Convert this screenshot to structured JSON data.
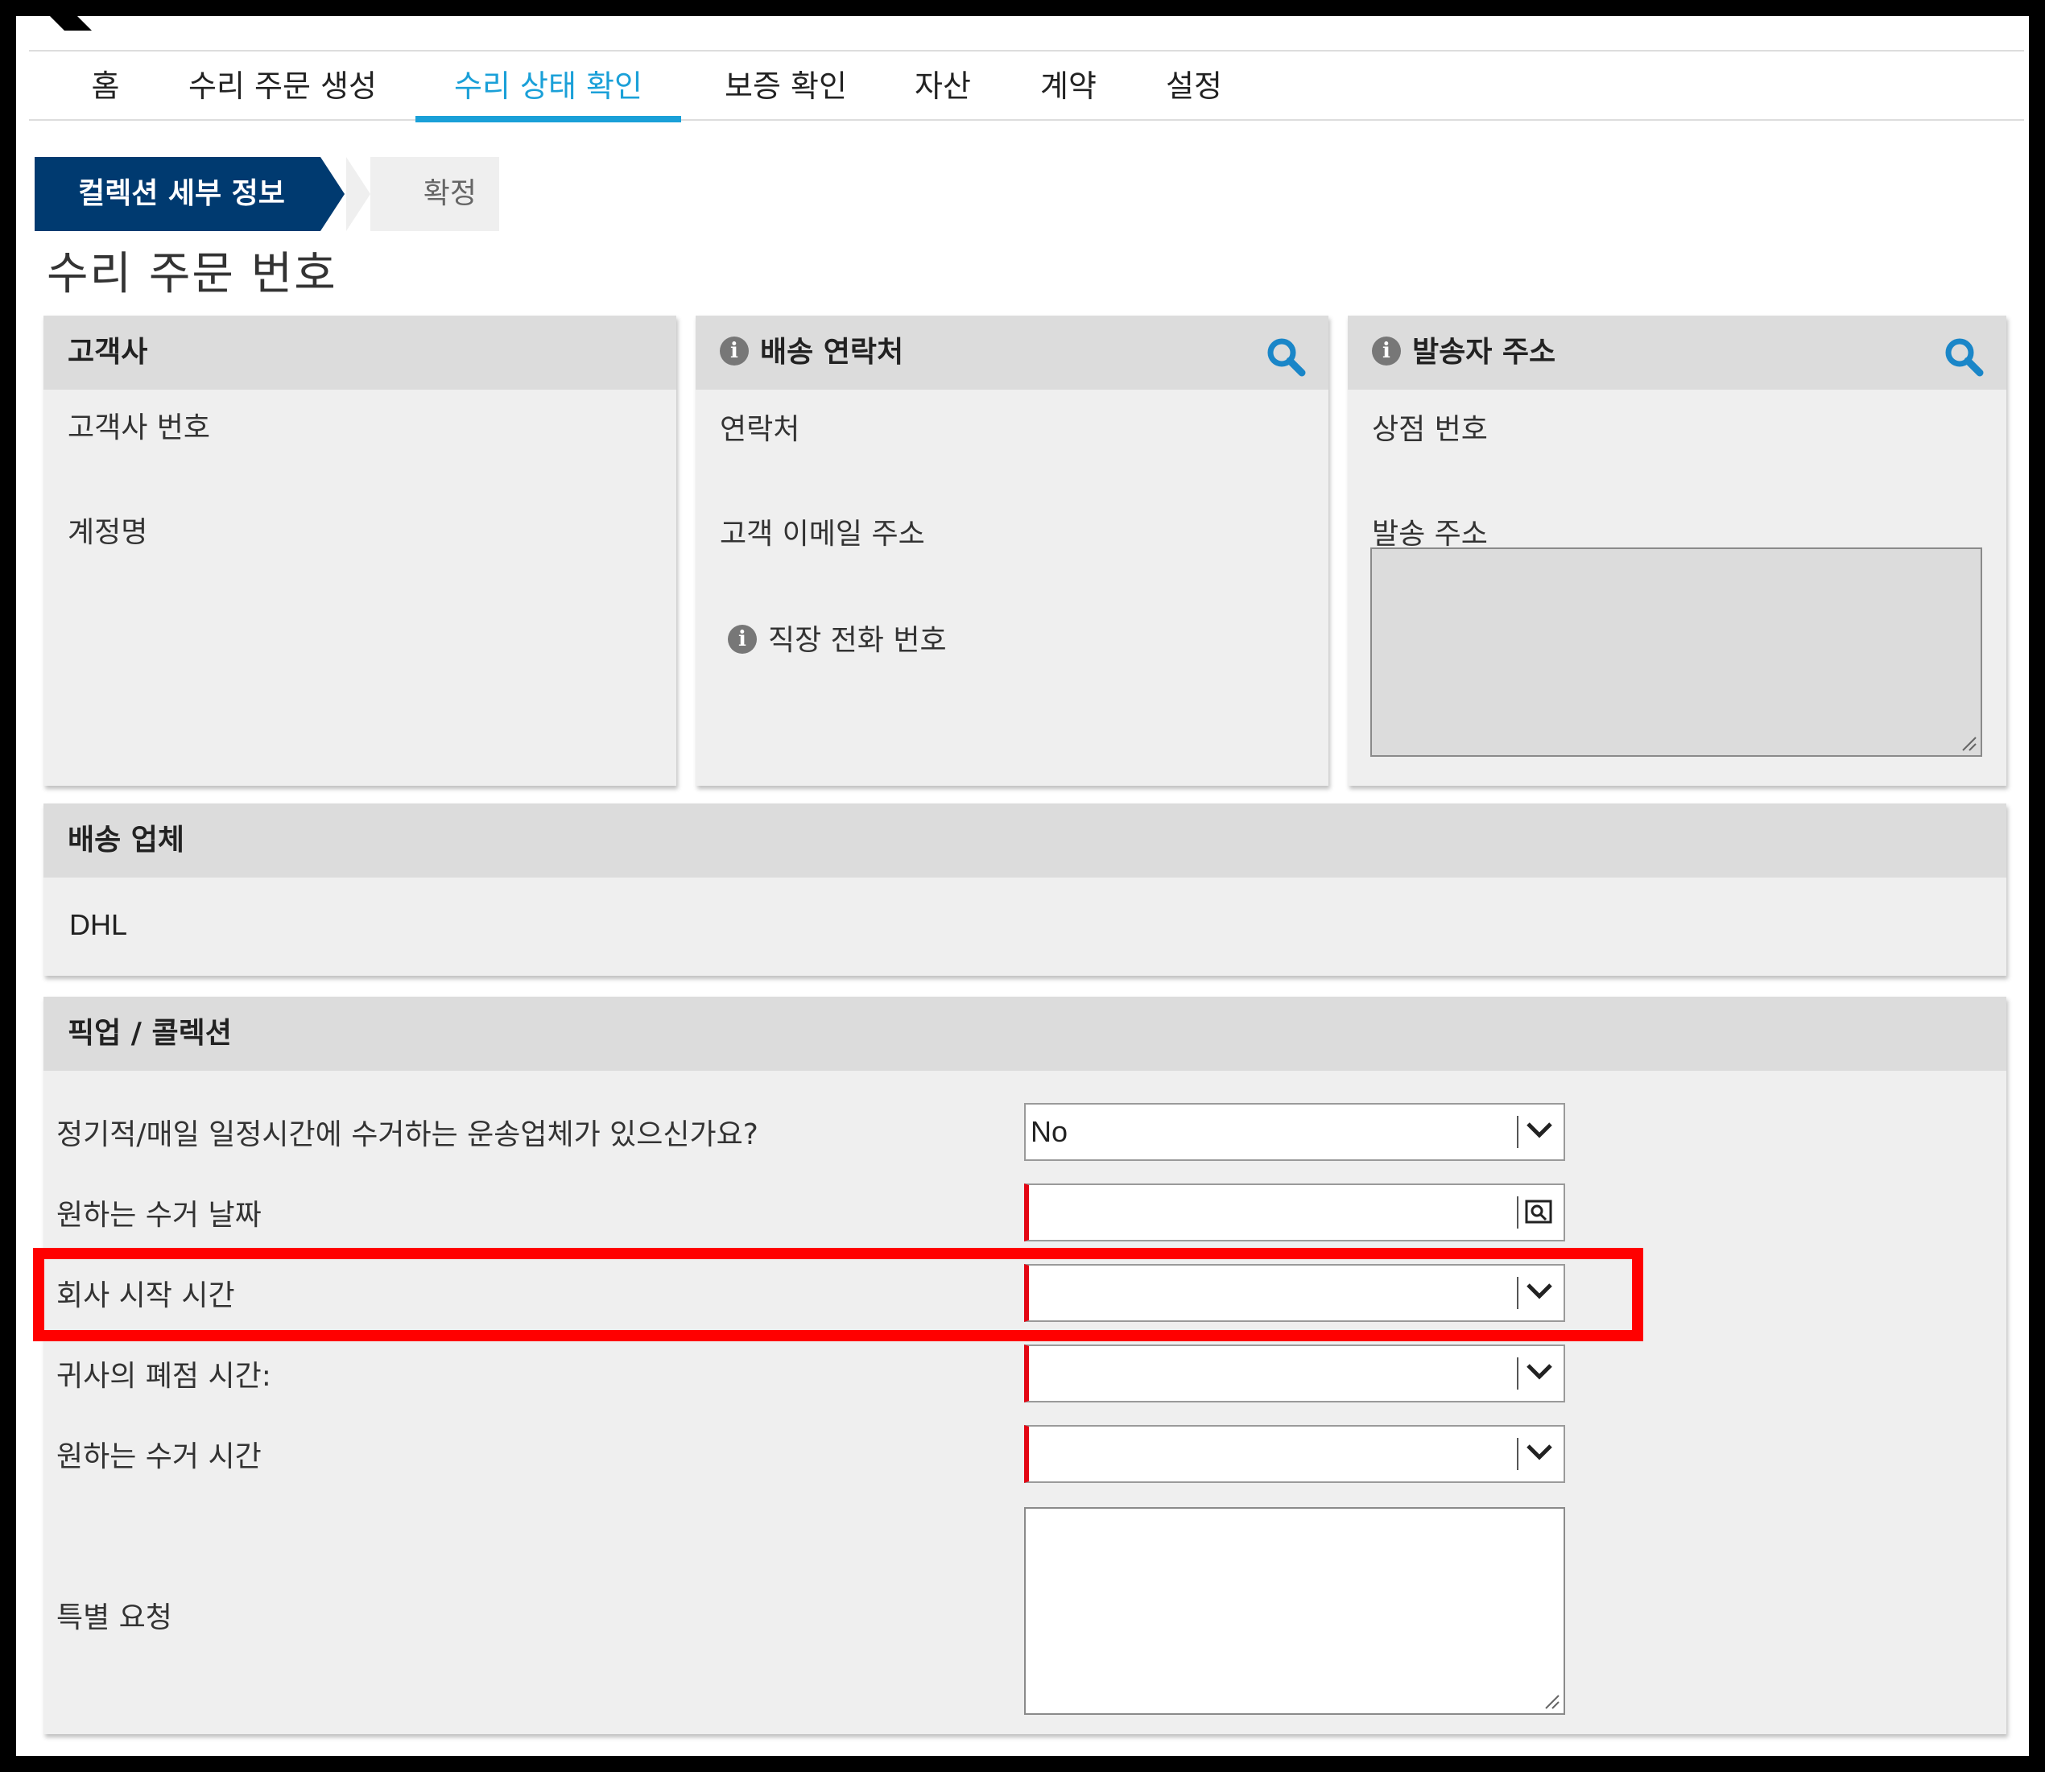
{
  "nav": {
    "tabs": [
      {
        "label": "홈"
      },
      {
        "label": "수리 주문 생성"
      },
      {
        "label": "수리 상태 확인"
      },
      {
        "label": "보증 확인"
      },
      {
        "label": "자산"
      },
      {
        "label": "계약"
      },
      {
        "label": "설정"
      }
    ],
    "active_index": 2
  },
  "steps": {
    "current": "컬렉션 세부 정보",
    "next": "확정"
  },
  "page_title": "수리 주문 번호",
  "customer_panel": {
    "title": "고객사",
    "fields": [
      "고객사 번호",
      "계정명"
    ]
  },
  "shipping_contact_panel": {
    "title": "배송 연락처",
    "fields": [
      "연락처",
      "고객 이메일 주소",
      "직장 전화 번호"
    ]
  },
  "sender_address_panel": {
    "title": "발송자 주소",
    "fields": [
      "상점 번호",
      "발송 주소"
    ]
  },
  "carrier_panel": {
    "title": "배송 업체",
    "value": "DHL"
  },
  "pickup_panel": {
    "title": "픽업 / 콜렉션",
    "rows": [
      {
        "label": "정기적/매일 일정시간에 수거하는 운송업체가 있으신가요?",
        "value": "No"
      },
      {
        "label": "원하는 수거 날짜",
        "value": ""
      },
      {
        "label": "회사 시작 시간",
        "value": ""
      },
      {
        "label": "귀사의 폐점 시간:",
        "value": ""
      },
      {
        "label": "원하는 수거 시간",
        "value": ""
      },
      {
        "label": "특별 요청",
        "value": ""
      }
    ]
  },
  "colors": {
    "nav_active": "#1aa0d8",
    "step_active_bg": "#003a70",
    "required_marker": "#e30613",
    "highlight": "#ff0000",
    "search_icon": "#1a86c8"
  },
  "icons": [
    "info-icon",
    "search-icon",
    "chevron-down-icon",
    "calendar-icon",
    "resize-grip-icon"
  ]
}
